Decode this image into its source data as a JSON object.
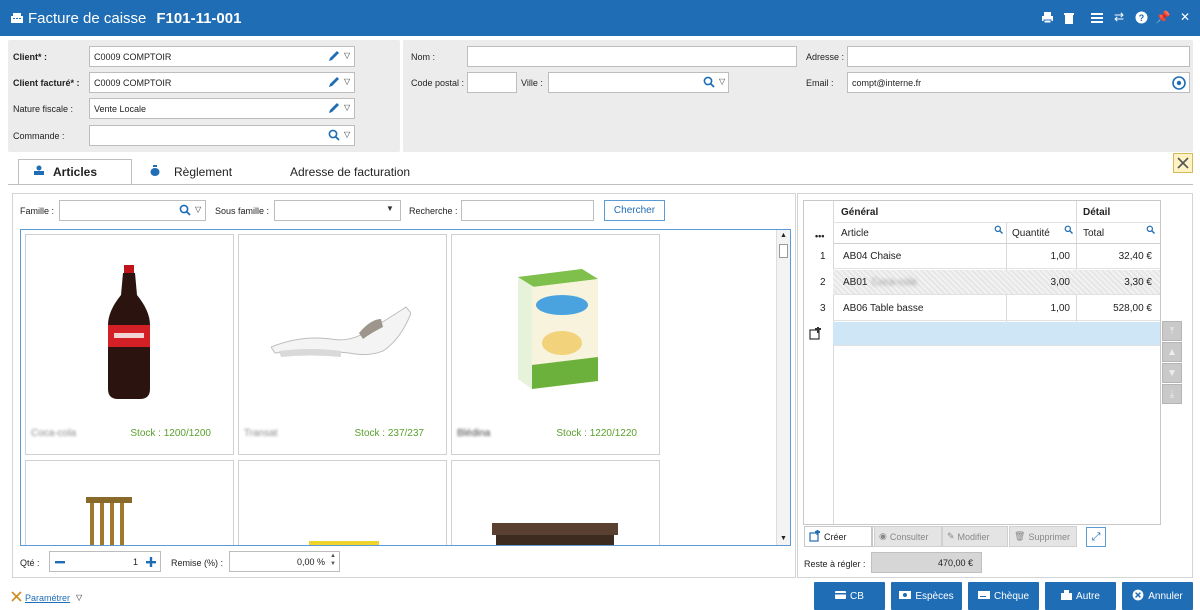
{
  "title": {
    "label": "Facture de caisse",
    "number": "F101-11-001"
  },
  "client": {
    "client_label": "Client* :",
    "client_value": "C0009 COMPTOIR",
    "billed_label": "Client facturé* :",
    "billed_value": "C0009 COMPTOIR",
    "fiscal_label": "Nature fiscale :",
    "fiscal_value": "Vente Locale",
    "order_label": "Commande :",
    "order_value": ""
  },
  "contact": {
    "name_label": "Nom :",
    "name_value": "",
    "postal_label": "Code postal :",
    "postal_value": "",
    "city_label": "Ville :",
    "city_value": "",
    "address_label": "Adresse :",
    "address_value": "",
    "email_label": "Email :",
    "email_value": "compt@interne.fr"
  },
  "tabs": [
    {
      "label": "Articles",
      "active": true
    },
    {
      "label": "Règlement",
      "active": false
    },
    {
      "label": "Adresse de facturation",
      "active": false
    }
  ],
  "filters": {
    "family_label": "Famille :",
    "subfamily_label": "Sous famille :",
    "search_label": "Recherche :",
    "search_button": "Chercher"
  },
  "products": [
    {
      "name": "Coca-cola",
      "stock": "Stock : 1200/1200"
    },
    {
      "name": "Transat",
      "stock": "Stock : 237/237"
    },
    {
      "name": "Blédina",
      "stock": "Stock : 1220/1220"
    }
  ],
  "bottom_left": {
    "qty_label": "Qté :",
    "qty_value": "1",
    "discount_label": "Remise (%) :",
    "discount_value": "0,00 %"
  },
  "table": {
    "group_general": "Général",
    "group_detail": "Détail",
    "col_article": "Article",
    "col_quantity": "Quantité",
    "col_total": "Total",
    "more": "•••",
    "rows": [
      {
        "num": "1",
        "article": "AB04 Chaise",
        "qty": "1,00",
        "total": "32,40 €"
      },
      {
        "num": "2",
        "article": "AB01 Coca-cola",
        "qty": "3,00",
        "total": "3,30 €"
      },
      {
        "num": "3",
        "article": "AB06 Table basse",
        "qty": "1,00",
        "total": "528,00 €"
      }
    ]
  },
  "actions": {
    "create": "Créer",
    "consult": "Consulter",
    "modify": "Modifier",
    "delete": "Supprimer"
  },
  "remaining": {
    "label": "Reste à régler :",
    "value": "470,00 €"
  },
  "settings_label": "Paramétrer",
  "payments": [
    "CB",
    "Espèces",
    "Chèque",
    "Autre",
    "Annuler"
  ],
  "colors": {
    "accent": "#1f6db5",
    "stock_green": "#5aa02c",
    "selected_row": "#cfe6f7"
  }
}
